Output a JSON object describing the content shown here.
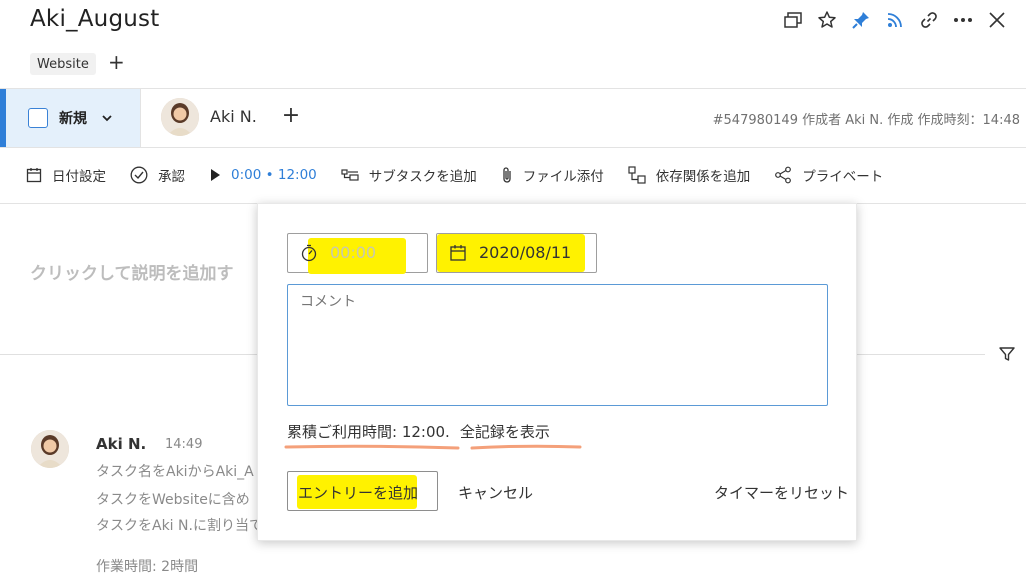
{
  "task": {
    "title": "Aki_August",
    "tag": "Website",
    "tag_add": "+"
  },
  "header_icons": [
    "window-icon",
    "star-icon",
    "pin-icon",
    "rss-icon",
    "link-icon",
    "more-icon",
    "close-icon"
  ],
  "status": {
    "label": "新規"
  },
  "assignee": {
    "name": "Aki N.",
    "add": "+"
  },
  "meta": "#547980149  作成者 Aki N. 作成  作成時刻：14:48",
  "toolbar": {
    "date": "日付設定",
    "approve": "承認",
    "timer": "0:00 • 12:00",
    "subtask": "サブタスクを追加",
    "attach": "ファイル添付",
    "dependency": "依存関係を追加",
    "private": "プライベート"
  },
  "description_placeholder": "クリックして説明を追加す",
  "activity": {
    "author": "Aki N.",
    "time": "14:49",
    "lines": [
      "タスク名をAkiからAki_A",
      "タスクをWebsiteに含め",
      "タスクをAki N.に割り当て"
    ],
    "work_time": "作業時間: 2時間"
  },
  "popup": {
    "time_placeholder": "00:00",
    "date": "2020/08/11",
    "comment_placeholder": "コメント",
    "total_label": "累積ご利用時間: 12:00.",
    "show_all": "全記録を表示",
    "add_entry": "エントリーを追加",
    "cancel": "キャンセル",
    "reset_timer": "タイマーをリセット"
  },
  "colors": {
    "accent": "#2f7fd8",
    "highlight": "#fff200",
    "underline": "#f4a07a"
  }
}
